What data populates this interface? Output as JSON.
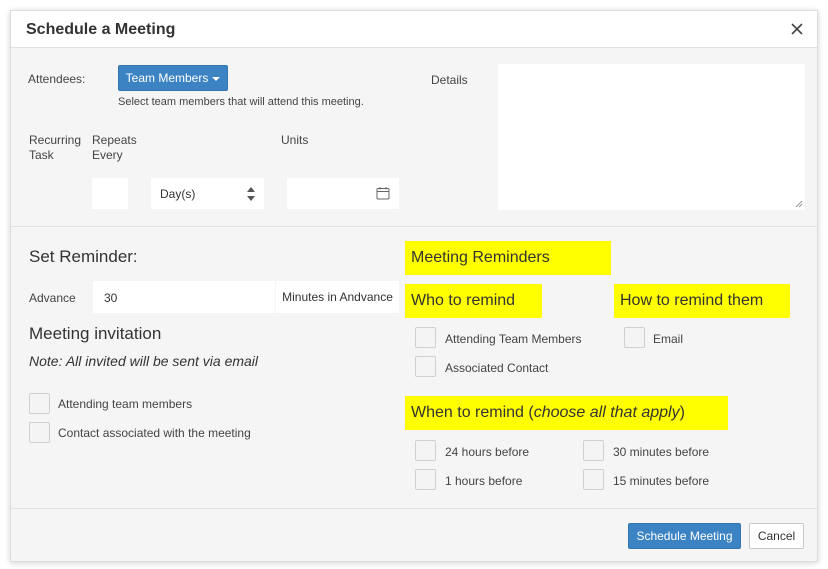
{
  "modal": {
    "title": "Schedule a Meeting"
  },
  "attendees": {
    "label": "Attendees:",
    "button_label": "Team Members",
    "help_text": "Select team members that will attend this meeting."
  },
  "details": {
    "label": "Details",
    "value": ""
  },
  "recurring": {
    "label_line1": "Recurring",
    "label_line2": "Task",
    "repeats_line1": "Repeats",
    "repeats_line2": "Every",
    "units_label": "Units",
    "repeats_value": "",
    "period_selected": "Day(s)",
    "units_value": ""
  },
  "reminder": {
    "heading": "Set Reminder:",
    "advance_label": "Advance",
    "advance_value": "30",
    "advance_suffix": "Minutes in Andvance"
  },
  "invitation": {
    "heading": "Meeting invitation",
    "note": "Note: All invited will be sent via email",
    "options": [
      {
        "label": "Attending team members",
        "checked": false
      },
      {
        "label": "Contact associated with the meeting",
        "checked": false
      }
    ]
  },
  "meeting_reminders": {
    "heading": "Meeting Reminders",
    "who_heading": "Who to remind",
    "who_options": [
      {
        "label": "Attending Team Members",
        "checked": false
      },
      {
        "label": "Associated Contact",
        "checked": false
      }
    ],
    "how_heading": "How to remind them",
    "how_options": [
      {
        "label": "Email",
        "checked": false
      }
    ],
    "when_heading_prefix": "When to remind (",
    "when_heading_italic": "choose all that apply",
    "when_heading_suffix": ")",
    "when_options": [
      {
        "label": "24 hours before",
        "checked": false
      },
      {
        "label": "30 minutes before",
        "checked": false
      },
      {
        "label": "1 hours before",
        "checked": false
      },
      {
        "label": "15 minutes before",
        "checked": false
      }
    ],
    "highlight_color": "#ffff00"
  },
  "footer": {
    "schedule_label": "Schedule Meeting",
    "cancel_label": "Cancel"
  },
  "colors": {
    "primary": "#3c83c4",
    "background": "#f5f5f5"
  },
  "icons": {
    "close": "close-icon",
    "caret": "caret-down-icon",
    "select_arrows": "select-arrows-icon",
    "calendar": "calendar-icon"
  }
}
